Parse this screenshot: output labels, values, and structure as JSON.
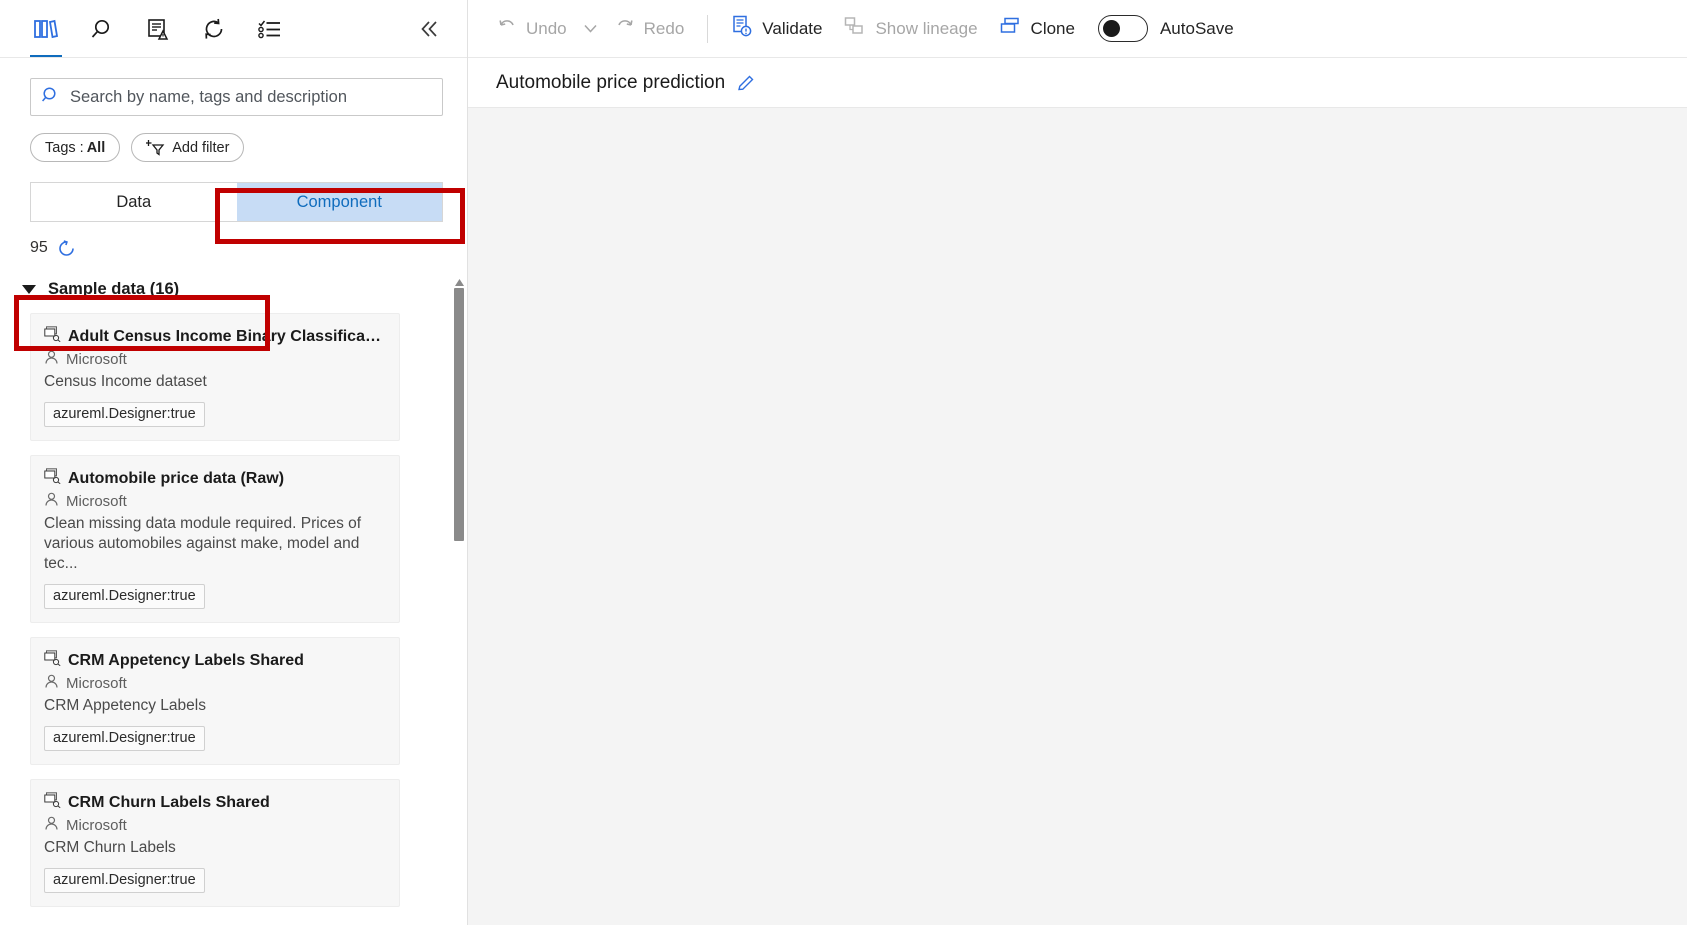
{
  "left_panel": {
    "icon_bar": {
      "icons": [
        {
          "name": "library-icon",
          "label": "Asset library"
        },
        {
          "name": "search-icon",
          "label": "Search"
        },
        {
          "name": "registry-icon",
          "label": "Registry"
        },
        {
          "name": "refresh-icon",
          "label": "Refresh"
        },
        {
          "name": "list-icon",
          "label": "List view"
        }
      ],
      "collapse_label": "«"
    },
    "search": {
      "placeholder": "Search by name, tags and description",
      "value": ""
    },
    "filters": {
      "tags_chip_label": "Tags : ",
      "tags_chip_value": "All",
      "add_filter_label": "Add filter"
    },
    "tabs": [
      {
        "label": "Data",
        "active": false
      },
      {
        "label": "Component",
        "active": true
      }
    ],
    "count": "95",
    "group": {
      "label": "Sample data (16)",
      "expanded": true
    },
    "cards": [
      {
        "title": "Adult Census Income Binary Classification dat...",
        "owner": "Microsoft",
        "description": "Census Income dataset",
        "tag": "azureml.Designer:true"
      },
      {
        "title": "Automobile price data (Raw)",
        "owner": "Microsoft",
        "description": "Clean missing data module required. Prices of various automobiles against make, model and tec...",
        "tag": "azureml.Designer:true"
      },
      {
        "title": "CRM Appetency Labels Shared",
        "owner": "Microsoft",
        "description": "CRM Appetency Labels",
        "tag": "azureml.Designer:true"
      },
      {
        "title": "CRM Churn Labels Shared",
        "owner": "Microsoft",
        "description": "CRM Churn Labels",
        "tag": "azureml.Designer:true"
      }
    ]
  },
  "toolbar": {
    "undo_label": "Undo",
    "redo_label": "Redo",
    "validate_label": "Validate",
    "show_lineage_label": "Show lineage",
    "clone_label": "Clone",
    "autosave_label": "AutoSave",
    "autosave_on": false
  },
  "title_bar": {
    "title": "Automobile price prediction"
  },
  "colors": {
    "accent": "#0f6cbd",
    "tab_active_bg": "#c7dcf5",
    "highlight_box": "#c00000",
    "canvas_bg": "#f4f4f4",
    "card_bg": "#f7f7f7"
  },
  "annotations": {
    "highlight_component_tab": true,
    "highlight_sample_data_group": true
  }
}
